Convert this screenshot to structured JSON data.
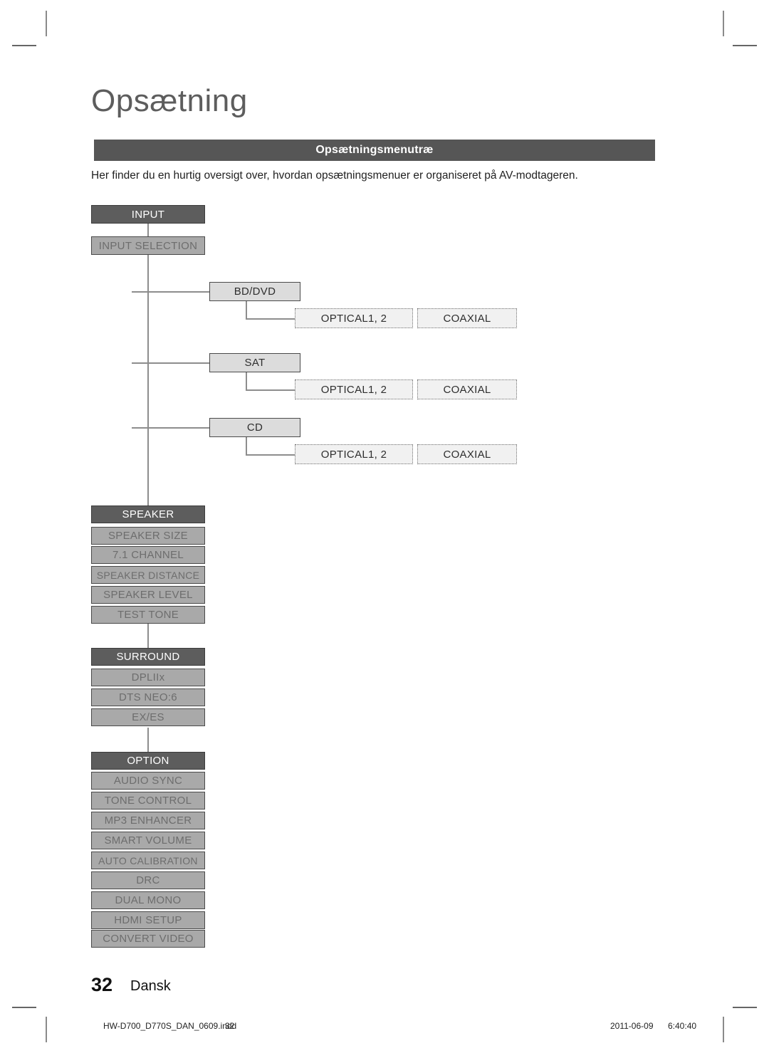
{
  "page": {
    "title": "Opsætning",
    "banner": "Opsætningsmenutræ",
    "intro": "Her finder du en hurtig oversigt over, hvordan opsætningsmenuer er organiseret på AV-modtageren.",
    "number": "32",
    "language": "Dansk"
  },
  "footer": {
    "file": "HW-D700_D770S_DAN_0609.indd",
    "page": "32",
    "date": "2011-06-09",
    "time": "6:40:40"
  },
  "colors": {
    "header_node": "#5d5d5d",
    "item_node": "#a9a9a9",
    "source_node": "#dcdcdc",
    "leaf_node": "#f1f1f1",
    "banner": "#565656",
    "connector": "#8d8d8d"
  },
  "tree": {
    "input": {
      "header": "INPUT",
      "selection": "INPUT SELECTION",
      "sources": [
        {
          "name": "BD/DVD",
          "leaves": [
            "OPTICAL1, 2",
            "COAXIAL"
          ]
        },
        {
          "name": "SAT",
          "leaves": [
            "OPTICAL1, 2",
            "COAXIAL"
          ]
        },
        {
          "name": "CD",
          "leaves": [
            "OPTICAL1, 2",
            "COAXIAL"
          ]
        }
      ]
    },
    "speaker": {
      "header": "SPEAKER",
      "items": [
        "SPEAKER SIZE",
        "7.1 CHANNEL",
        "SPEAKER DISTANCE",
        "SPEAKER LEVEL",
        "TEST TONE"
      ]
    },
    "surround": {
      "header": "SURROUND",
      "items": [
        "DPLIIx",
        "DTS NEO:6",
        "EX/ES"
      ]
    },
    "option": {
      "header": "OPTION",
      "items": [
        "AUDIO SYNC",
        "TONE CONTROL",
        "MP3 ENHANCER",
        "SMART VOLUME",
        "AUTO CALIBRATION",
        "DRC",
        "DUAL MONO",
        "HDMI SETUP",
        "CONVERT VIDEO"
      ]
    }
  }
}
